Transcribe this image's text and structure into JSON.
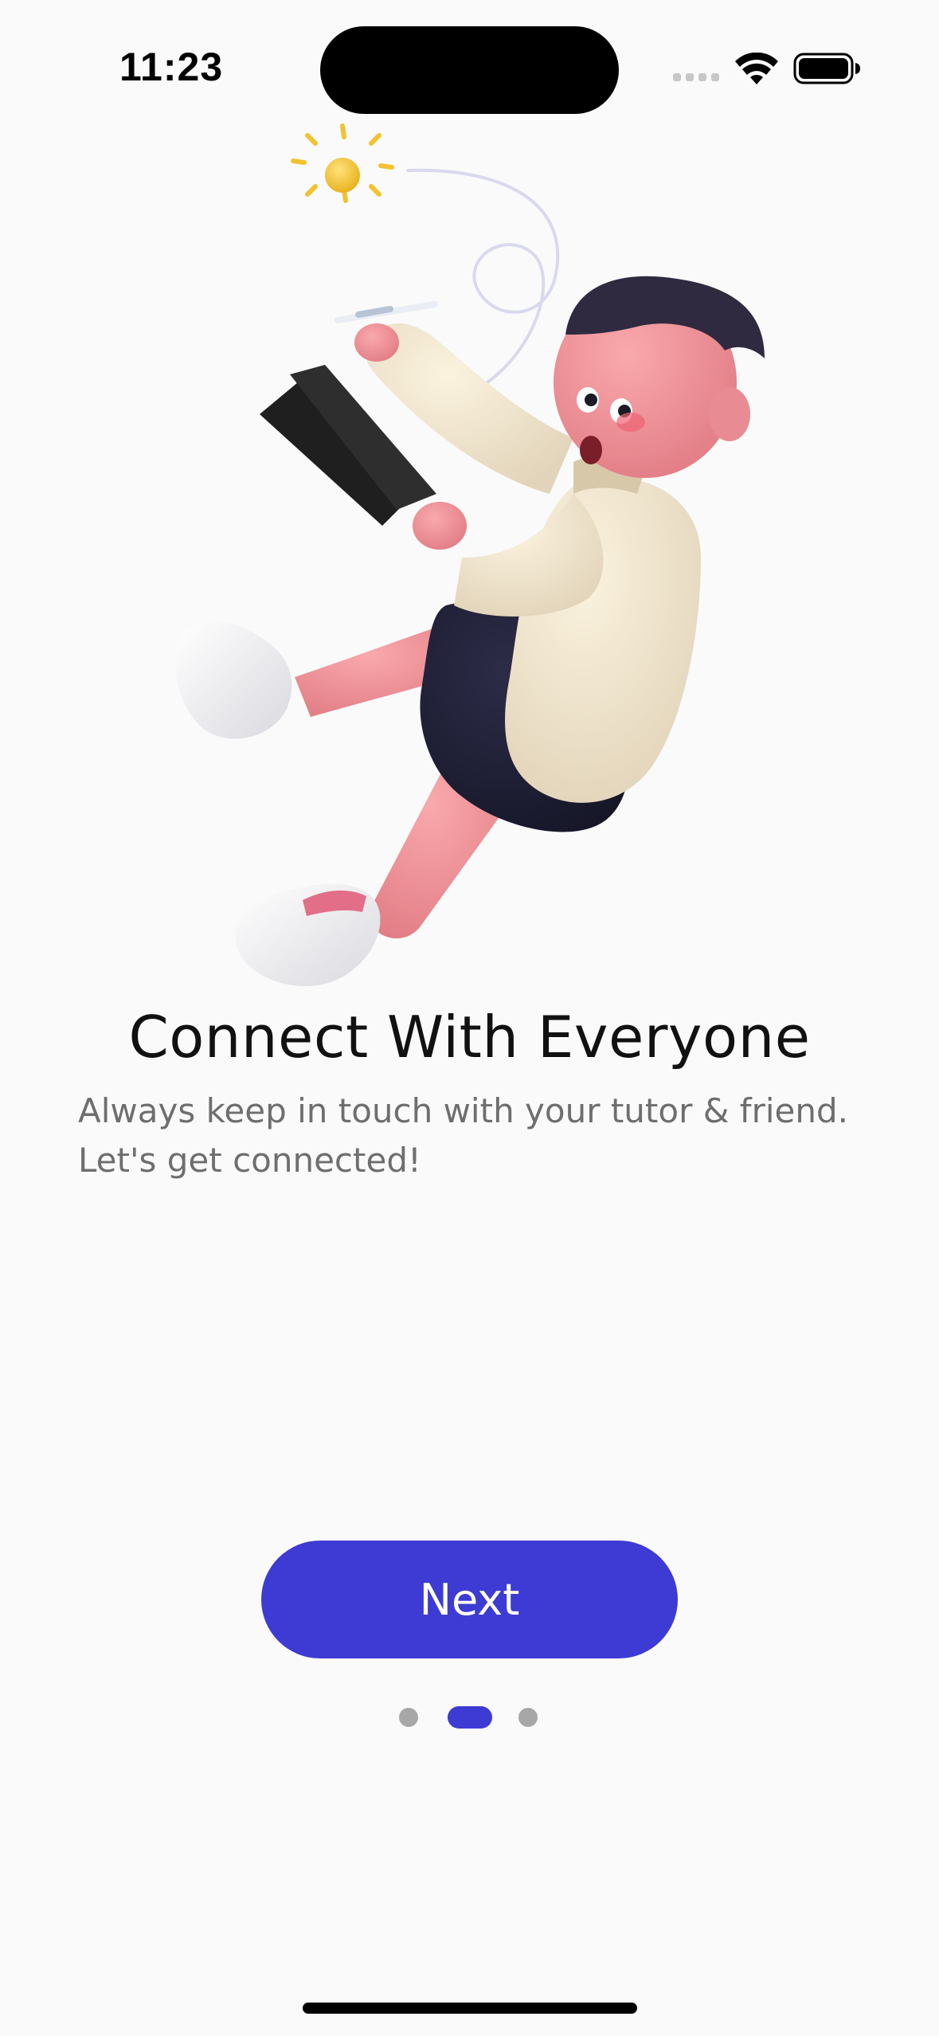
{
  "status_bar": {
    "time": "11:23",
    "icons": [
      "cellular-signal-icon",
      "wifi-icon",
      "battery-icon"
    ]
  },
  "illustration": {
    "icon": "person-with-tablet-illustration"
  },
  "onboarding": {
    "title": "Connect With Everyone",
    "subtitle": "Always keep in touch with your tutor & friend.\nLet's get connected!"
  },
  "actions": {
    "next_label": "Next"
  },
  "page_indicator": {
    "total_pages": 3,
    "current_page": 2
  },
  "colors": {
    "accent": "#3d3bd4",
    "background": "#fafafa",
    "inactive_dot": "#a7a7a7",
    "title_text": "#111111",
    "subtitle_text": "#6e6e6e"
  }
}
